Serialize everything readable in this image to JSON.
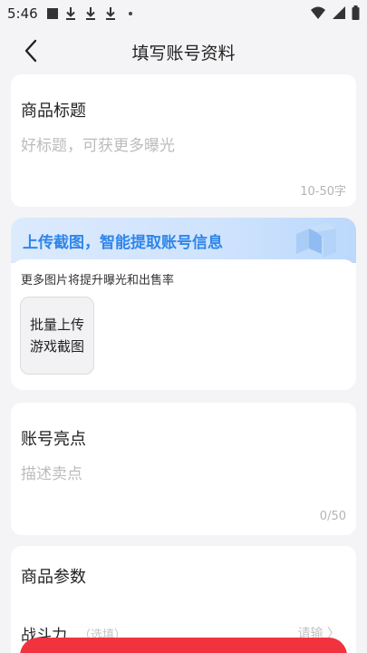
{
  "status_bar": {
    "time": "5:46"
  },
  "header": {
    "title": "填写账号资料"
  },
  "title_card": {
    "label": "商品标题",
    "placeholder": "好标题，可获更多曝光",
    "counter": "10-50字"
  },
  "upload": {
    "banner_title": "上传截图，智能提取账号信息",
    "hint": "更多图片将提升曝光和出售率",
    "box_line1": "批量上传",
    "box_line2": "游戏截图"
  },
  "highlight_card": {
    "label": "账号亮点",
    "placeholder": "描述卖点",
    "counter": "0/50"
  },
  "params_card": {
    "label": "商品参数",
    "row_label": "战斗力",
    "row_optional": "（选填）",
    "row_select": "请输 〉"
  },
  "colors": {
    "accent_blue": "#2f86ea",
    "primary_red": "#f2323f",
    "placeholder_gray": "#bcbcbc"
  },
  "icons": [
    "back-arrow-icon",
    "wifi-icon",
    "signal-icon",
    "battery-icon",
    "download-icon"
  ]
}
